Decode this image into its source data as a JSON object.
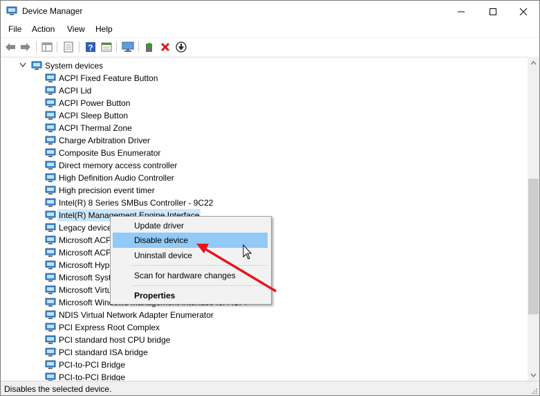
{
  "window": {
    "title": "Device Manager",
    "icon": "device-manager-icon"
  },
  "menu": [
    "File",
    "Action",
    "View",
    "Help"
  ],
  "toolbar": [
    "back-arrow-icon",
    "forward-arrow-icon",
    "show-hide-tree-icon",
    "properties-icon",
    "help-icon",
    "view-icon",
    "computer-monitor-icon",
    "update-driver-icon",
    "uninstall-x-icon",
    "disable-down-icon"
  ],
  "tree": {
    "category": "System devices",
    "devices": [
      "ACPI Fixed Feature Button",
      "ACPI Lid",
      "ACPI Power Button",
      "ACPI Sleep Button",
      "ACPI Thermal Zone",
      "Charge Arbitration Driver",
      "Composite Bus Enumerator",
      "Direct memory access controller",
      "High Definition Audio Controller",
      "High precision event timer",
      "Intel(R) 8 Series SMBus Controller - 9C22",
      "Intel(R) Management Engine Interface",
      "Legacy device",
      "Microsoft ACPI-Compliant Embedded Controller",
      "Microsoft ACPI-Compliant System",
      "Microsoft Hyper-V Virtualization Infrastructure Driver",
      "Microsoft System Management BIOS Driver",
      "Microsoft Virtual Drive Enumerator",
      "Microsoft Windows Management Interface for ACPI",
      "NDIS Virtual Network Adapter Enumerator",
      "PCI Express Root Complex",
      "PCI standard host CPU bridge",
      "PCI standard ISA bridge",
      "PCI-to-PCI Bridge",
      "PCI-to-PCI Bridge"
    ]
  },
  "context_menu": {
    "items": [
      "Update driver",
      "Disable device",
      "Uninstall device",
      "Scan for hardware changes",
      "Properties"
    ],
    "highlighted": "Disable device"
  },
  "status": {
    "text": "Disables the selected device."
  },
  "colors": {
    "selection": "#cce8ff",
    "menu_highlight": "#91c9f7",
    "annotation_arrow": "#e8141c"
  }
}
